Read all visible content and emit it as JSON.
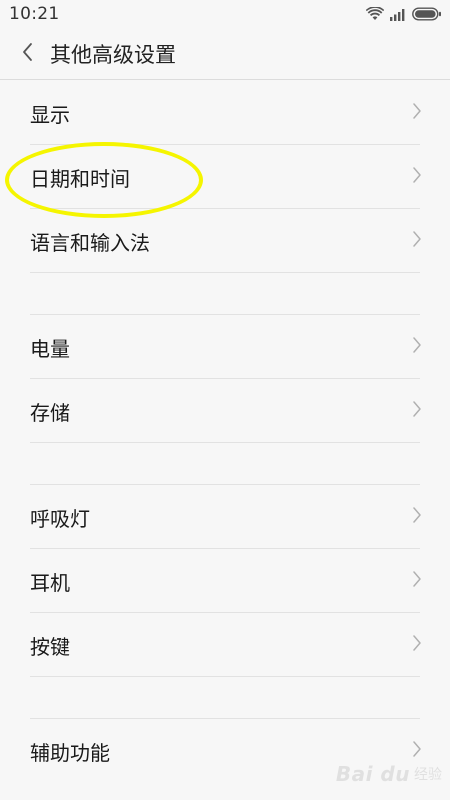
{
  "status_bar": {
    "time": "10:21"
  },
  "header": {
    "title": "其他高级设置"
  },
  "groups": [
    {
      "items": [
        {
          "label": "显示"
        },
        {
          "label": "日期和时间"
        },
        {
          "label": "语言和输入法"
        }
      ]
    },
    {
      "items": [
        {
          "label": "电量"
        },
        {
          "label": "存储"
        }
      ]
    },
    {
      "items": [
        {
          "label": "呼吸灯"
        },
        {
          "label": "耳机"
        },
        {
          "label": "按键"
        }
      ]
    },
    {
      "items": [
        {
          "label": "辅助功能"
        }
      ]
    }
  ],
  "watermark": {
    "text": "Bai du",
    "sub": "经验"
  },
  "colors": {
    "background": "#f7f7f7",
    "divider": "#e2e2e2",
    "highlight": "#f5f500",
    "chevron": "#b0b0b0"
  }
}
